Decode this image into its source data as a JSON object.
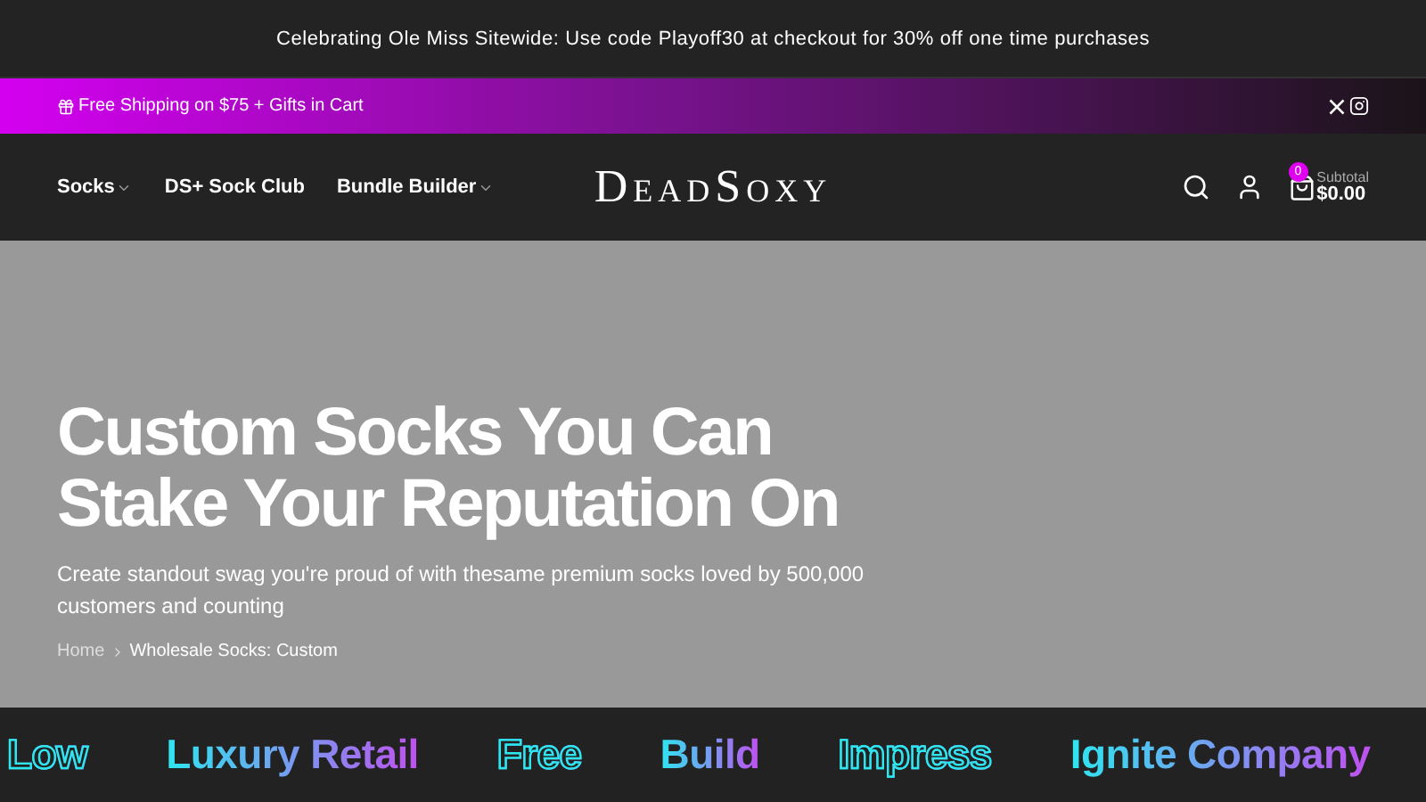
{
  "announcement": "Celebrating Ole Miss Sitewide: Use code Playoff30 at checkout for 30% off one time purchases",
  "promo_bar": {
    "text": "Free Shipping on $75 + Gifts in Cart"
  },
  "nav": {
    "items": [
      {
        "label": "Socks",
        "dropdown": true
      },
      {
        "label": "DS+ Sock Club",
        "dropdown": false
      },
      {
        "label": "Bundle Builder",
        "dropdown": true
      }
    ],
    "logo": "DeadSoxy",
    "cart": {
      "count": "0",
      "subtotal_label": "Subtotal",
      "subtotal": "$0.00"
    }
  },
  "hero": {
    "title": "Custom Socks You Can Stake Your Reputation On",
    "subtitle": "Create standout swag you're proud of with thesame premium socks loved by 500,000 customers and counting",
    "breadcrumb": [
      {
        "label": "Home",
        "current": false
      },
      {
        "label": "Wholesale Socks: Custom",
        "current": true
      }
    ]
  },
  "marquee": [
    {
      "text": "Low",
      "kind": "outline"
    },
    {
      "text": "Luxury Retail",
      "kind": "solid"
    },
    {
      "text": "Free",
      "kind": "outline"
    },
    {
      "text": "Build",
      "kind": "solid"
    },
    {
      "text": "Impress",
      "kind": "outline"
    },
    {
      "text": "Ignite Company",
      "kind": "solid"
    }
  ]
}
